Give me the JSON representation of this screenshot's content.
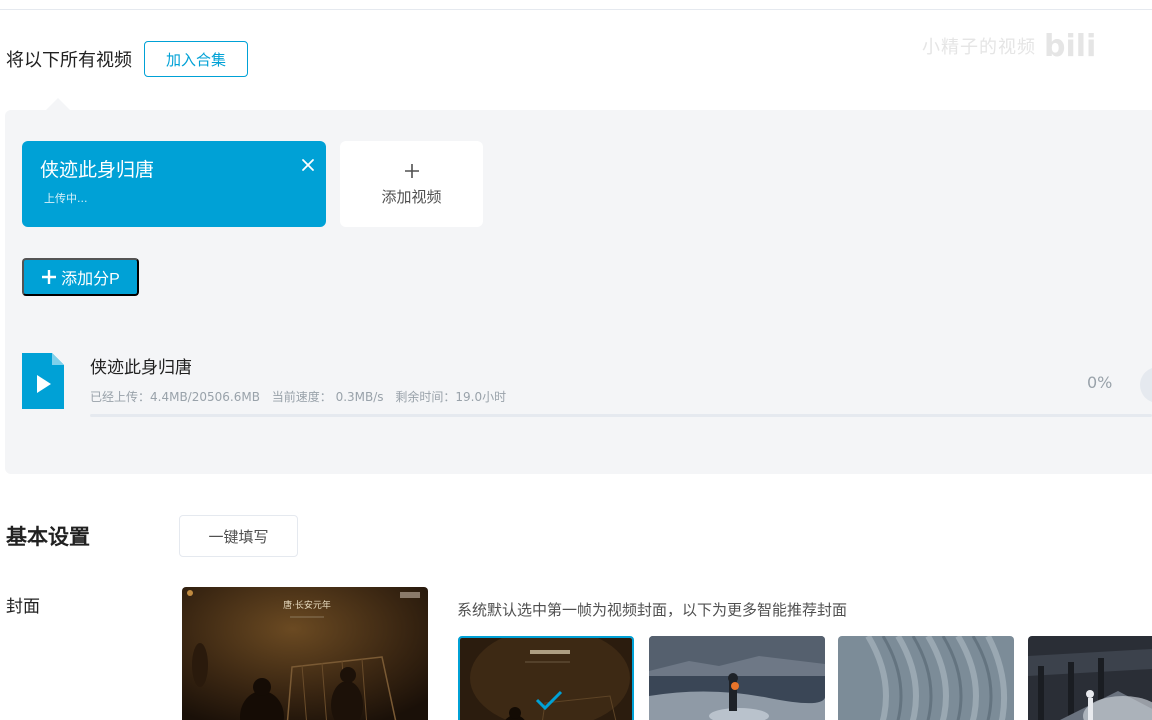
{
  "collection": {
    "label": "将以下所有视频",
    "button": "加入合集"
  },
  "watermark": {
    "text": "小精子的视频",
    "logo": "bili"
  },
  "p_card": {
    "title": "侠迹此身归唐",
    "status": "上传中..."
  },
  "add_video": {
    "label": "添加视频"
  },
  "add_p": {
    "label": "添加分P"
  },
  "upload": {
    "filename": "侠迹此身归唐",
    "uploaded": "已经上传：4.4MB/20506.6MB",
    "speed": "当前速度： 0.3MB/s",
    "remaining": "剩余时间：19.0小时",
    "percent_text": "0%",
    "progress": 0
  },
  "basic": {
    "title": "基本设置",
    "autofill": "一键填写"
  },
  "cover": {
    "label": "封面",
    "hint": "系统默认选中第一帧为视频封面，以下为更多智能推荐封面",
    "title_art": "唐·长安元年"
  },
  "colors": {
    "accent": "#00a1d6",
    "panel": "#f4f5f7"
  }
}
